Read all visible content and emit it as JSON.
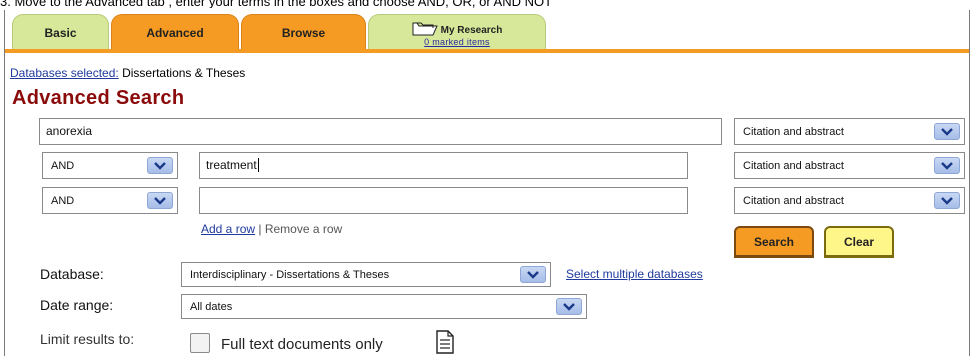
{
  "top_instruction": "3. Move to the Advanced tab                    , enter your terms in the boxes and choose AND, OR, or AND NOT",
  "tabs": {
    "basic": "Basic",
    "advanced": "Advanced",
    "browse": "Browse",
    "my_research": "My Research",
    "marked_items": "0 marked items"
  },
  "databases_selected_label": "Databases selected:",
  "databases_selected_value": "Dissertations & Theses",
  "heading": "Advanced Search",
  "rows": [
    {
      "operator": "",
      "term": "anorexia",
      "field": "Citation and abstract"
    },
    {
      "operator": "AND",
      "term": "treatment",
      "field": "Citation and abstract"
    },
    {
      "operator": "AND",
      "term": "",
      "field": "Citation and abstract"
    }
  ],
  "add_row": "Add a row",
  "separator": "|",
  "remove_row": "Remove a row",
  "buttons": {
    "search": "Search",
    "clear": "Clear"
  },
  "database_label": "Database:",
  "database_value": "Interdisciplinary - Dissertations & Theses",
  "select_multiple": "Select multiple databases",
  "date_range_label": "Date range:",
  "date_range_value": "All dates",
  "limit_label": "Limit results to:",
  "full_text_label": "Full text documents only",
  "colors": {
    "tab_orange": "#f59b23",
    "tab_green": "#d8e89a",
    "heading_red": "#8b0a0a",
    "link_blue": "#1f3a9c",
    "clear_yellow": "#fff68a"
  }
}
